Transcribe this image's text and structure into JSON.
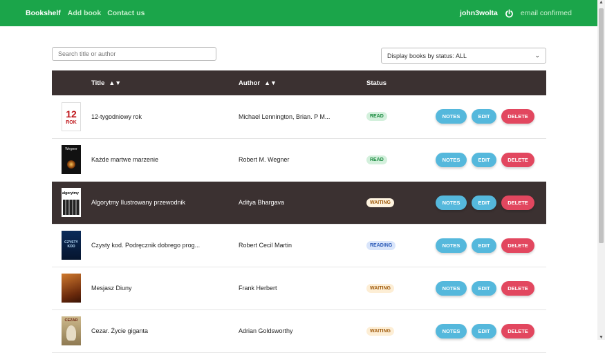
{
  "nav": {
    "brand": "Bookshelf",
    "add_book": "Add book",
    "contact": "Contact us",
    "username": "john3wolta",
    "power_icon": "power-icon",
    "email_status": "email confirmed"
  },
  "search": {
    "placeholder": "Search title or author",
    "value": ""
  },
  "filter": {
    "label": "Display books by status: ALL"
  },
  "table": {
    "headers": {
      "title": "Title",
      "author": "Author",
      "status": "Status"
    },
    "rows": [
      {
        "title": "12-tygodniowy rok",
        "author": "Michael Lennington, Brian. P M...",
        "status": "READ",
        "cover_text": "12 ROK"
      },
      {
        "title": "Każde martwe marzenie",
        "author": "Robert M. Wegner",
        "status": "READ",
        "cover_text": "Wegner"
      },
      {
        "title": "Algorytmy Ilustrowany przewodnik",
        "author": "Aditya Bhargava",
        "status": "WAITING",
        "cover_text": "algorytmy"
      },
      {
        "title": "Czysty kod. Podręcznik dobrego prog...",
        "author": "Robert Cecil Martin",
        "status": "READING",
        "cover_text": "CZYSTY KOD"
      },
      {
        "title": "Mesjasz Diuny",
        "author": "Frank Herbert",
        "status": "WAITING",
        "cover_text": ""
      },
      {
        "title": "Cezar. Życie giganta",
        "author": "Adrian Goldsworthy",
        "status": "WAITING",
        "cover_text": "CEZAR"
      }
    ],
    "actions": {
      "notes": "NOTES",
      "edit": "EDIT",
      "delete": "DELETE"
    }
  },
  "colors": {
    "topbar": "#1ba54a",
    "header": "#3b3131",
    "notes_edit": "#55b8dc",
    "delete": "#e2475f"
  }
}
